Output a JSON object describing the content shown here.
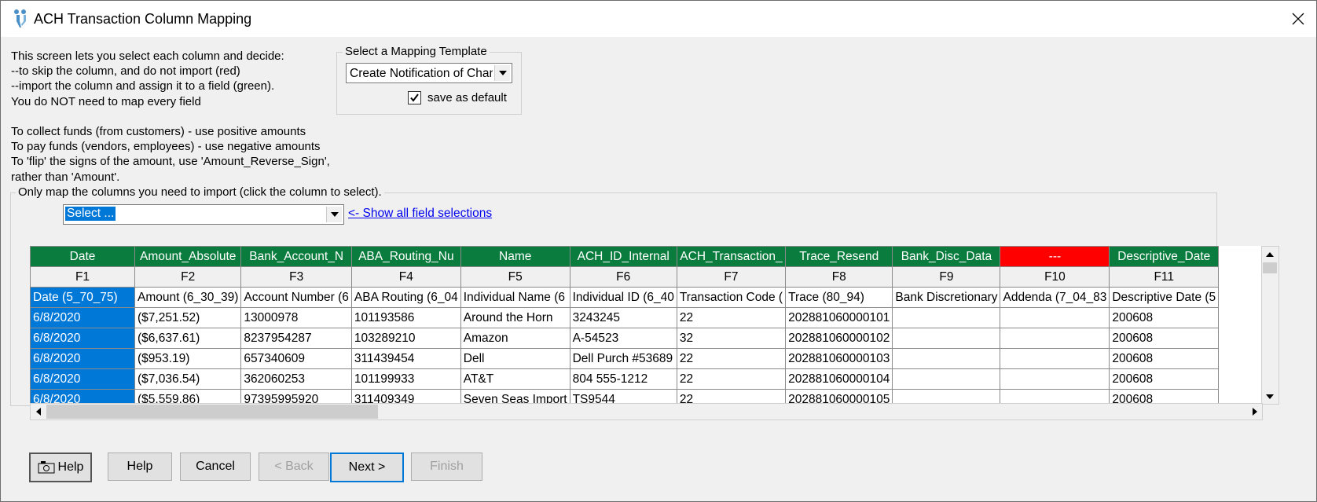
{
  "window": {
    "title": "ACH Transaction Column Mapping"
  },
  "intro_text": "This screen lets you select each column and decide:\n--to skip the column, and do not import (red)\n--import the column and assign it to a field (green).\nYou do NOT need to map every field\n\nTo collect funds (from customers) - use positive amounts\nTo pay funds (vendors, employees) - use negative amounts\nTo 'flip' the signs of the amount, use 'Amount_Reverse_Sign',\nrather than 'Amount'.",
  "template_group": {
    "legend": "Select a Mapping Template",
    "selected": "Create Notification of Change",
    "save_default_label": "save as default",
    "save_default_checked": true
  },
  "map_group": {
    "legend": "Only map the columns you need to import (click the column to select).",
    "field_select_value": "Select ...",
    "show_all_link": "<- Show all field selections"
  },
  "grid": {
    "columns": [
      {
        "mapping": "Date",
        "field": "F1",
        "source": "Date (5_70_75)",
        "status": "mapped"
      },
      {
        "mapping": "Amount_Absolute",
        "field": "F2",
        "source": "Amount (6_30_39)",
        "status": "mapped"
      },
      {
        "mapping": "Bank_Account_N",
        "field": "F3",
        "source": "Account Number (6",
        "status": "mapped"
      },
      {
        "mapping": "ABA_Routing_Nu",
        "field": "F4",
        "source": "ABA Routing (6_04",
        "status": "mapped"
      },
      {
        "mapping": "Name",
        "field": "F5",
        "source": "Individual Name (6",
        "status": "mapped"
      },
      {
        "mapping": "ACH_ID_Internal",
        "field": "F6",
        "source": "Individual ID (6_40",
        "status": "mapped"
      },
      {
        "mapping": "ACH_Transaction_",
        "field": "F7",
        "source": "Transaction Code (",
        "status": "mapped"
      },
      {
        "mapping": "Trace_Resend",
        "field": "F8",
        "source": "Trace (80_94)",
        "status": "mapped"
      },
      {
        "mapping": "Bank_Disc_Data",
        "field": "F9",
        "source": "Bank Discretionary",
        "status": "mapped"
      },
      {
        "mapping": "---",
        "field": "F10",
        "source": "Addenda (7_04_83",
        "status": "skipped"
      },
      {
        "mapping": "Descriptive_Date",
        "field": "F11",
        "source": "Descriptive Date (5",
        "status": "mapped"
      }
    ],
    "rows": [
      [
        "6/8/2020",
        "($7,251.52)",
        "13000978",
        "101193586",
        "Around the Horn",
        "3243245",
        "22",
        "202881060000101",
        "",
        "",
        "200608"
      ],
      [
        "6/8/2020",
        "($6,637.61)",
        "8237954287",
        "103289210",
        "Amazon",
        "A-54523",
        "32",
        "202881060000102",
        "",
        "",
        "200608"
      ],
      [
        "6/8/2020",
        "($953.19)",
        "657340609",
        "311439454",
        "Dell",
        "Dell Purch #53689",
        "22",
        "202881060000103",
        "",
        "",
        "200608"
      ],
      [
        "6/8/2020",
        "($7,036.54)",
        "362060253",
        "101199933",
        "AT&T",
        "804 555-1212",
        "22",
        "202881060000104",
        "",
        "",
        "200608"
      ],
      [
        "6/8/2020",
        "($5,559.86)",
        "97395995920",
        "311409349",
        "Seven Seas Import",
        "TS9544",
        "22",
        "202881060000105",
        "",
        "",
        "200608"
      ]
    ]
  },
  "buttons": {
    "help_icon_label": "Help",
    "help": "Help",
    "cancel": "Cancel",
    "back": "< Back",
    "next": "Next >",
    "finish": "Finish"
  },
  "colors": {
    "mapped": "#0a7d3e",
    "skipped": "#ff0000",
    "selection": "#0078d7"
  }
}
